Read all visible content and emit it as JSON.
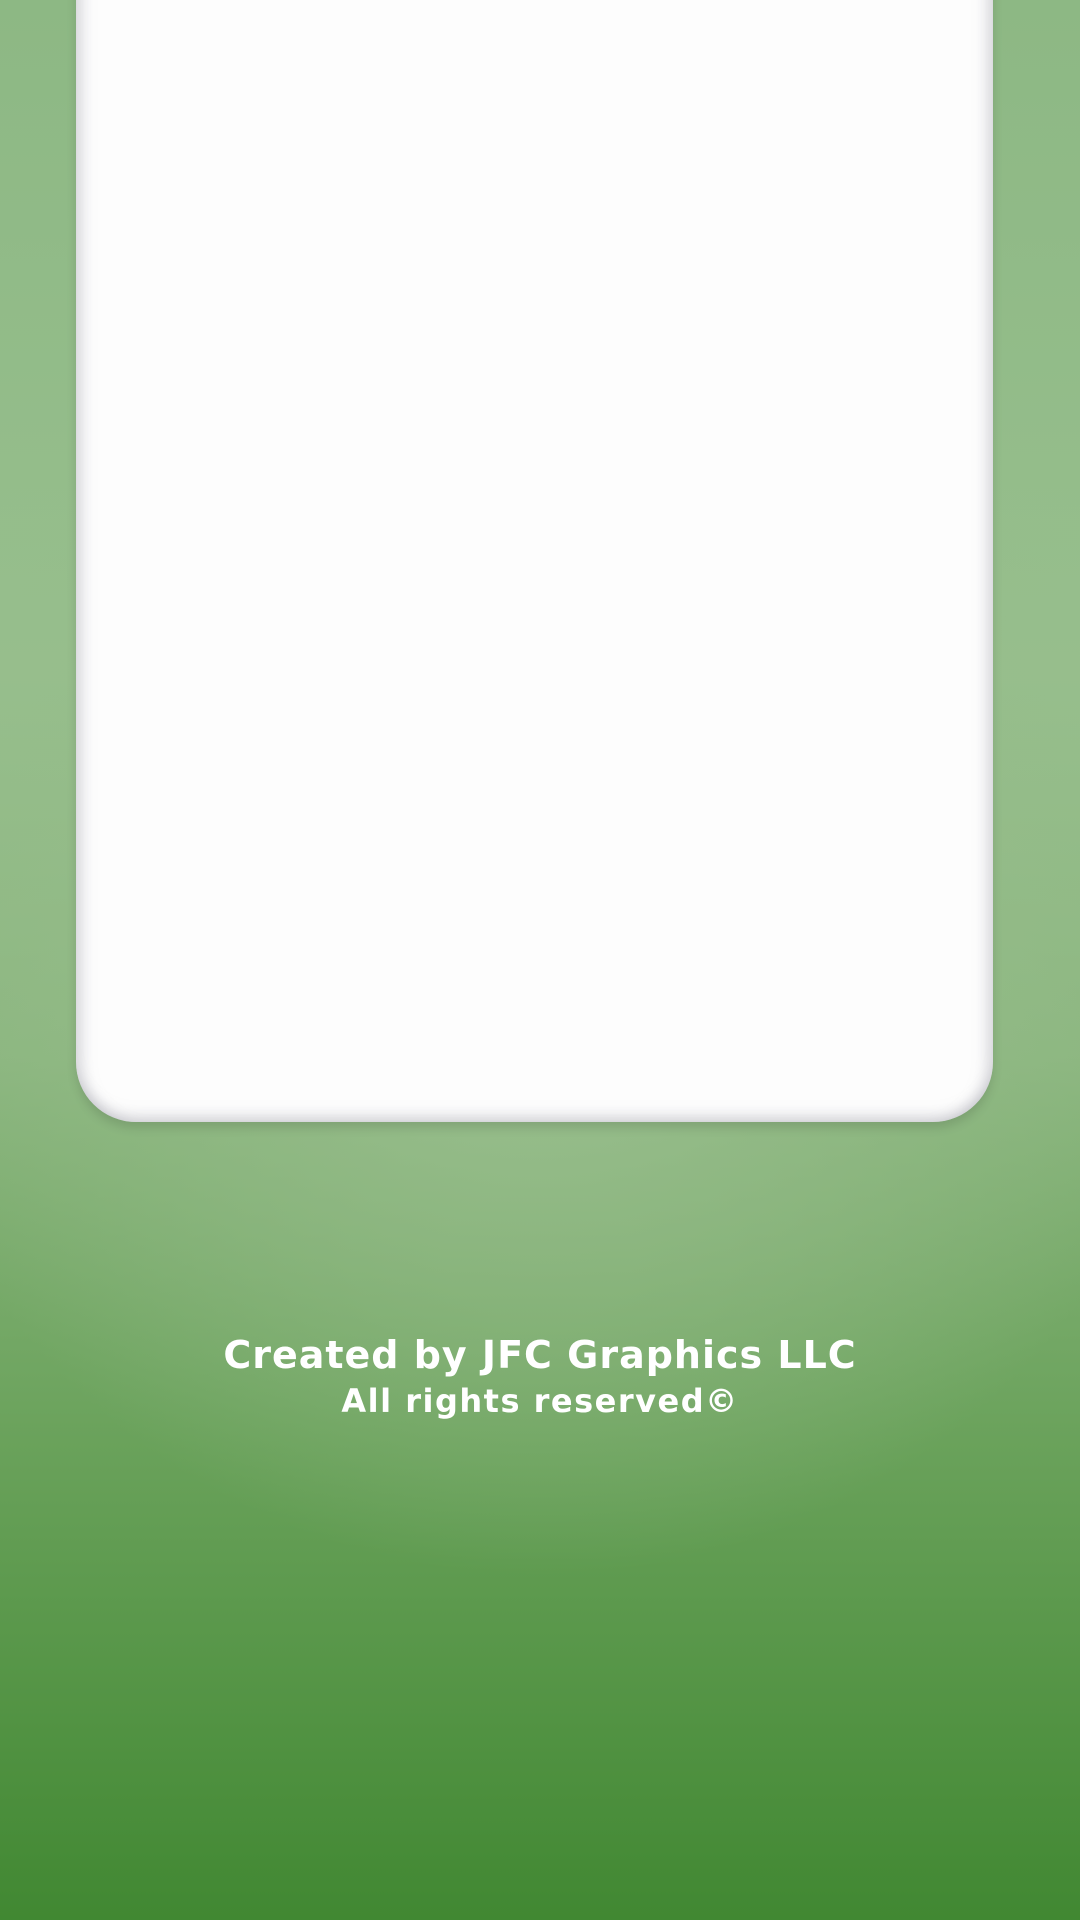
{
  "footer": {
    "credit_line": "Created by JFC Graphics LLC",
    "rights_line": "All rights reserved©"
  },
  "colors": {
    "background_top": "#8db884",
    "background_bottom": "#418832",
    "card_background": "#fdfdfd",
    "text": "#ffffff"
  }
}
